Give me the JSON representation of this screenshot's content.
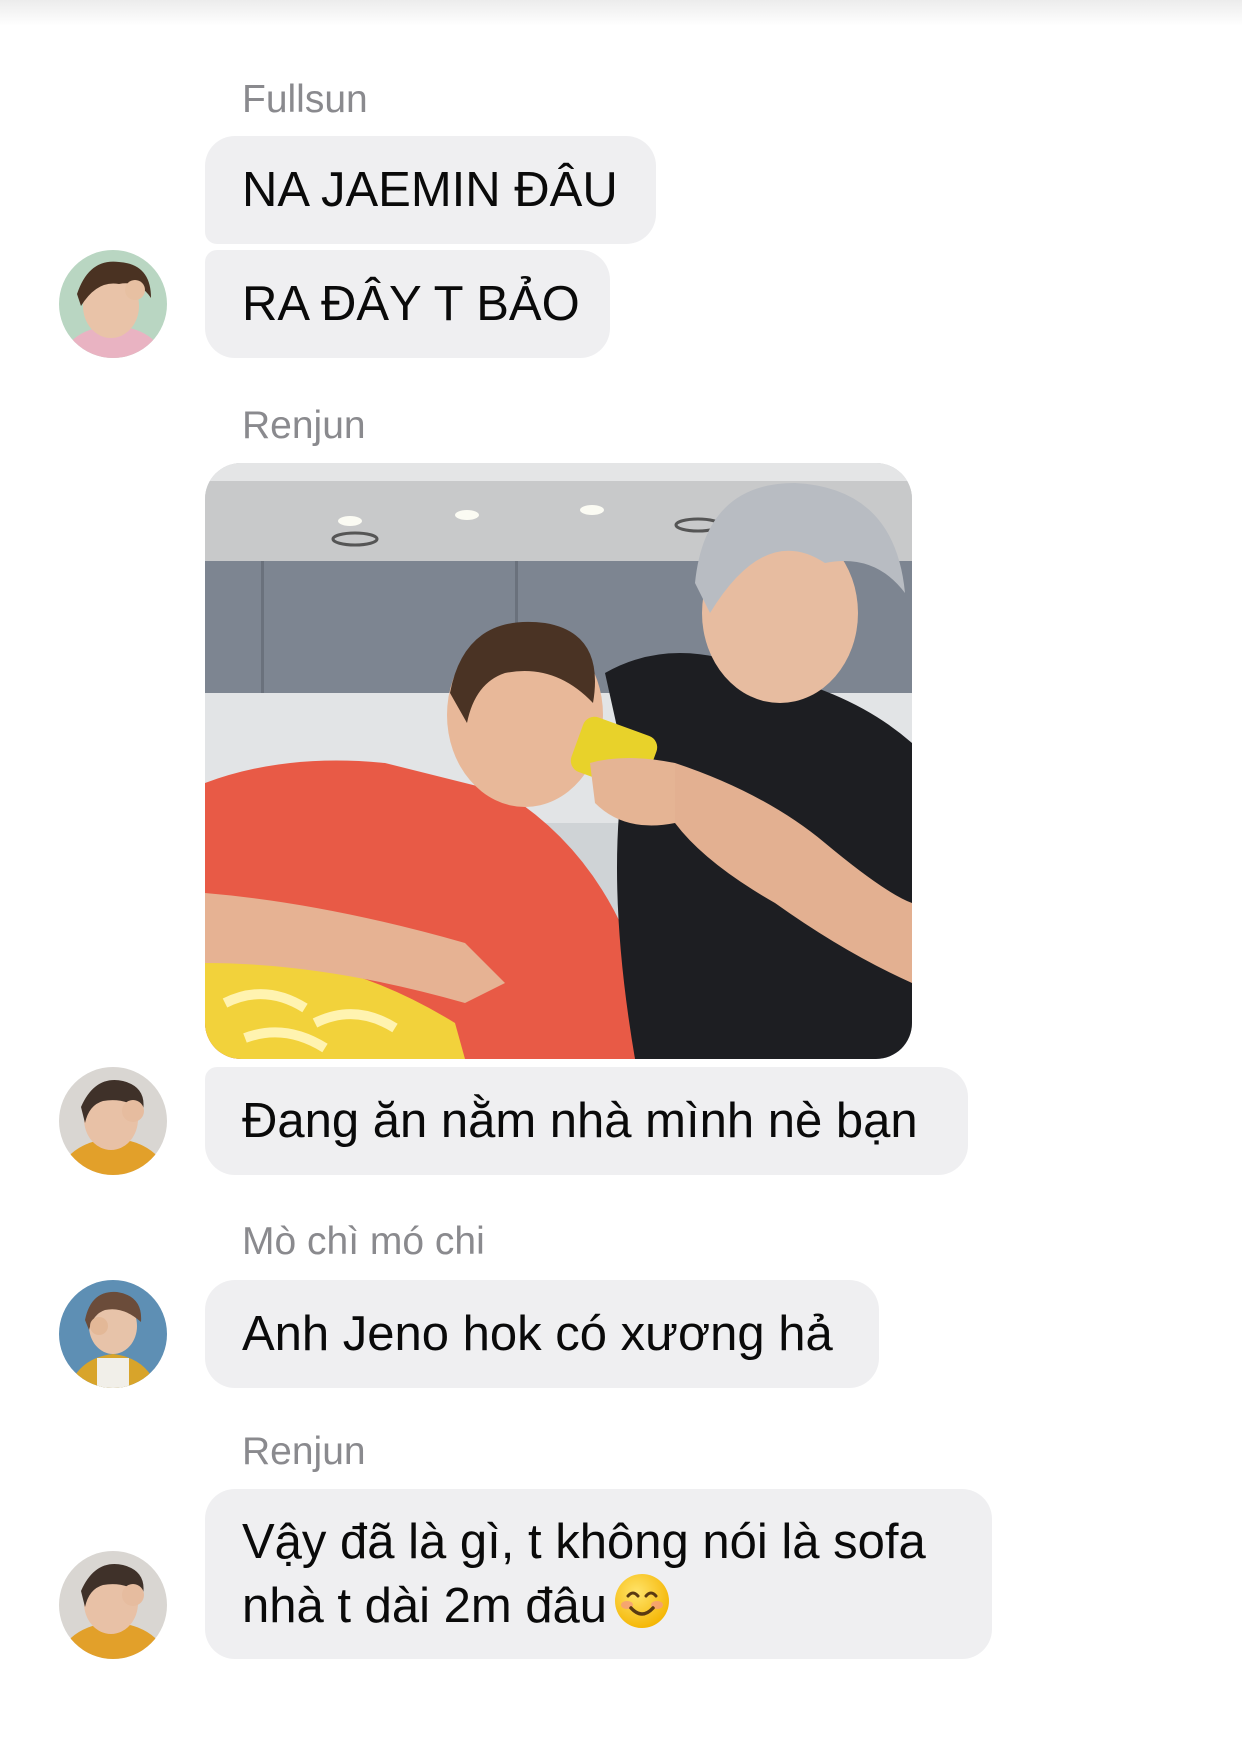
{
  "conversation": {
    "groups": [
      {
        "sender": "Fullsun",
        "messages": [
          "NA JAEMIN ĐÂU",
          "RA ĐÂY T BẢO"
        ]
      },
      {
        "sender": "Renjun",
        "photo_alt": "photo",
        "messages": [
          "Đang ăn nằm nhà mình nè bạn"
        ]
      },
      {
        "sender": "Mò chì mó chi",
        "messages": [
          "Anh Jeno hok có xương hả"
        ]
      },
      {
        "sender": "Renjun",
        "messages": [
          "Vậy đã là gì, t không nói là sofa",
          "nhà t dài 2m đâu"
        ],
        "emoji": "smiling-face-emoji"
      }
    ]
  },
  "colors": {
    "bubble_bg": "#efeff1",
    "name_text": "#8a8a8e",
    "message_text": "#0a0a0a"
  }
}
